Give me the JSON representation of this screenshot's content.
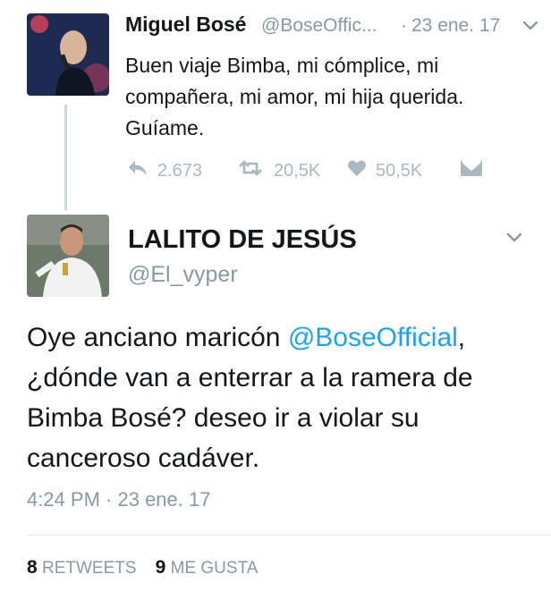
{
  "tweet1": {
    "author_name": "Miguel Bosé",
    "handle": "@BoseOffic...",
    "separator": "·",
    "time": "23 ene. 17",
    "text": "Buen viaje Bimba, mi cómplice, mi compañera, mi amor, mi hija querida. Guíame.",
    "actions": {
      "reply_count": "2.673",
      "retweet_count": "20,5K",
      "like_count": "50,5K"
    }
  },
  "tweet2": {
    "author_name": "LALITO DE JESÚS",
    "handle": "@El_vyper",
    "text_before": "Oye anciano maricón ",
    "mention": "@BoseOfficial",
    "text_after": ", ¿dónde van a enterrar a la ramera de Bimba Bosé? deseo ir a violar su canceroso cadáver.",
    "timestamp": "4:24 PM · 23 ene. 17",
    "retweets_count": "8",
    "retweets_label": "RETWEETS",
    "likes_count": "9",
    "likes_label": "ME GUSTA"
  },
  "colors": {
    "accent": "#1da1f2",
    "muted": "#8899a6",
    "action_icon": "#aab8c2",
    "text": "#14171a"
  },
  "icons": [
    "chevron-down-icon",
    "reply-icon",
    "retweet-icon",
    "heart-icon",
    "direct-message-icon"
  ]
}
